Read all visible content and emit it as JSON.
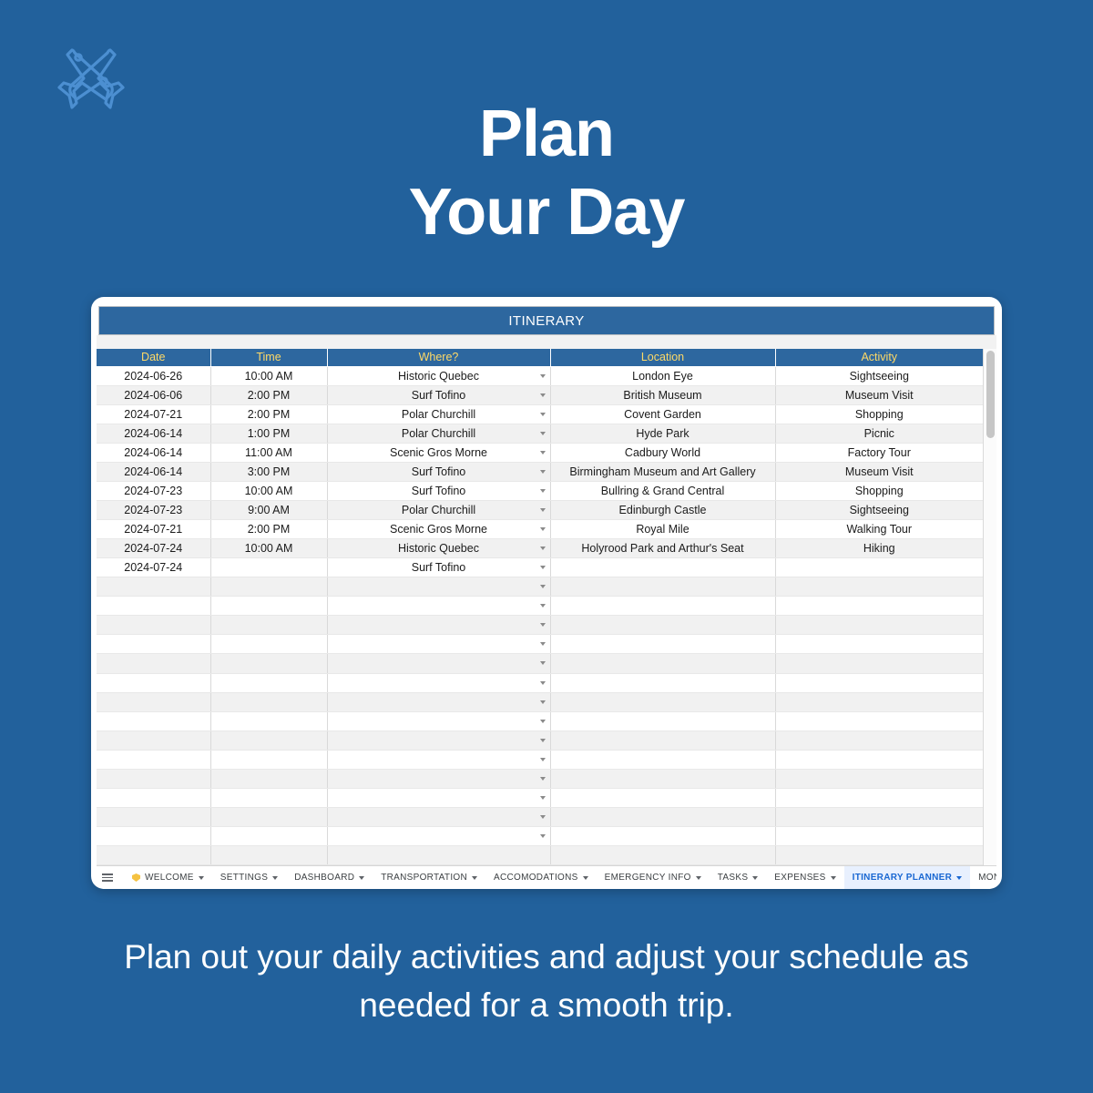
{
  "theme": {
    "background": "#22619C",
    "header_blue": "#2D679F",
    "header_text_gold": "#FFD966",
    "active_tab_blue": "#1967D2",
    "active_tab_bg": "#E8F0FE"
  },
  "logo": {
    "icon": "crossed-airplanes-icon"
  },
  "headline": {
    "line1": "Plan",
    "line2": "Your Day"
  },
  "caption": {
    "line1": "Plan out your daily activities and adjust your",
    "line2": "schedule as needed for a smooth trip."
  },
  "spreadsheet": {
    "banner_title": "ITINERARY",
    "columns": [
      "Date",
      "Time",
      "Where?",
      "Location",
      "Activity"
    ],
    "rows": [
      {
        "date": "2024-06-26",
        "time": "10:00 AM",
        "where": "Historic Quebec",
        "location": "London Eye",
        "activity": "Sightseeing"
      },
      {
        "date": "2024-06-06",
        "time": "2:00 PM",
        "where": "Surf Tofino",
        "location": "British Museum",
        "activity": "Museum Visit"
      },
      {
        "date": "2024-07-21",
        "time": "2:00 PM",
        "where": "Polar Churchill",
        "location": "Covent Garden",
        "activity": "Shopping"
      },
      {
        "date": "2024-06-14",
        "time": "1:00 PM",
        "where": "Polar Churchill",
        "location": "Hyde Park",
        "activity": "Picnic"
      },
      {
        "date": "2024-06-14",
        "time": "11:00 AM",
        "where": "Scenic Gros Morne",
        "location": "Cadbury World",
        "activity": "Factory Tour"
      },
      {
        "date": "2024-06-14",
        "time": "3:00 PM",
        "where": "Surf Tofino",
        "location": "Birmingham Museum and Art Gallery",
        "activity": "Museum Visit"
      },
      {
        "date": "2024-07-23",
        "time": "10:00 AM",
        "where": "Surf Tofino",
        "location": "Bullring & Grand Central",
        "activity": "Shopping"
      },
      {
        "date": "2024-07-23",
        "time": "9:00 AM",
        "where": "Polar Churchill",
        "location": "Edinburgh Castle",
        "activity": "Sightseeing"
      },
      {
        "date": "2024-07-21",
        "time": "2:00 PM",
        "where": "Scenic Gros Morne",
        "location": "Royal Mile",
        "activity": "Walking Tour"
      },
      {
        "date": "2024-07-24",
        "time": "10:00 AM",
        "where": "Historic Quebec",
        "location": "Holyrood Park and Arthur's Seat",
        "activity": "Hiking"
      },
      {
        "date": "2024-07-24",
        "time": "",
        "where": "Surf Tofino",
        "location": "",
        "activity": ""
      },
      {
        "date": "",
        "time": "",
        "where": "",
        "location": "",
        "activity": ""
      },
      {
        "date": "",
        "time": "",
        "where": "",
        "location": "",
        "activity": ""
      },
      {
        "date": "",
        "time": "",
        "where": "",
        "location": "",
        "activity": ""
      },
      {
        "date": "",
        "time": "",
        "where": "",
        "location": "",
        "activity": ""
      },
      {
        "date": "",
        "time": "",
        "where": "",
        "location": "",
        "activity": ""
      },
      {
        "date": "",
        "time": "",
        "where": "",
        "location": "",
        "activity": ""
      },
      {
        "date": "",
        "time": "",
        "where": "",
        "location": "",
        "activity": ""
      },
      {
        "date": "",
        "time": "",
        "where": "",
        "location": "",
        "activity": ""
      },
      {
        "date": "",
        "time": "",
        "where": "",
        "location": "",
        "activity": ""
      },
      {
        "date": "",
        "time": "",
        "where": "",
        "location": "",
        "activity": ""
      },
      {
        "date": "",
        "time": "",
        "where": "",
        "location": "",
        "activity": ""
      },
      {
        "date": "",
        "time": "",
        "where": "",
        "location": "",
        "activity": ""
      },
      {
        "date": "",
        "time": "",
        "where": "",
        "location": "",
        "activity": ""
      },
      {
        "date": "",
        "time": "",
        "where": "",
        "location": "",
        "activity": ""
      },
      {
        "date": "",
        "time": "",
        "where": "",
        "location": "",
        "activity": ""
      }
    ],
    "tabs": [
      {
        "label": "WELCOME",
        "active": false,
        "has_icon": true
      },
      {
        "label": "SETTINGS",
        "active": false,
        "has_icon": false
      },
      {
        "label": "DASHBOARD",
        "active": false,
        "has_icon": false
      },
      {
        "label": "TRANSPORTATION",
        "active": false,
        "has_icon": false
      },
      {
        "label": "ACCOMODATIONS",
        "active": false,
        "has_icon": false
      },
      {
        "label": "EMERGENCY INFO",
        "active": false,
        "has_icon": false
      },
      {
        "label": "TASKS",
        "active": false,
        "has_icon": false
      },
      {
        "label": "EXPENSES",
        "active": false,
        "has_icon": false
      },
      {
        "label": "ITINERARY PLANNER",
        "active": true,
        "has_icon": false
      },
      {
        "label": "MONTH VIEW",
        "active": false,
        "has_icon": false
      }
    ]
  }
}
